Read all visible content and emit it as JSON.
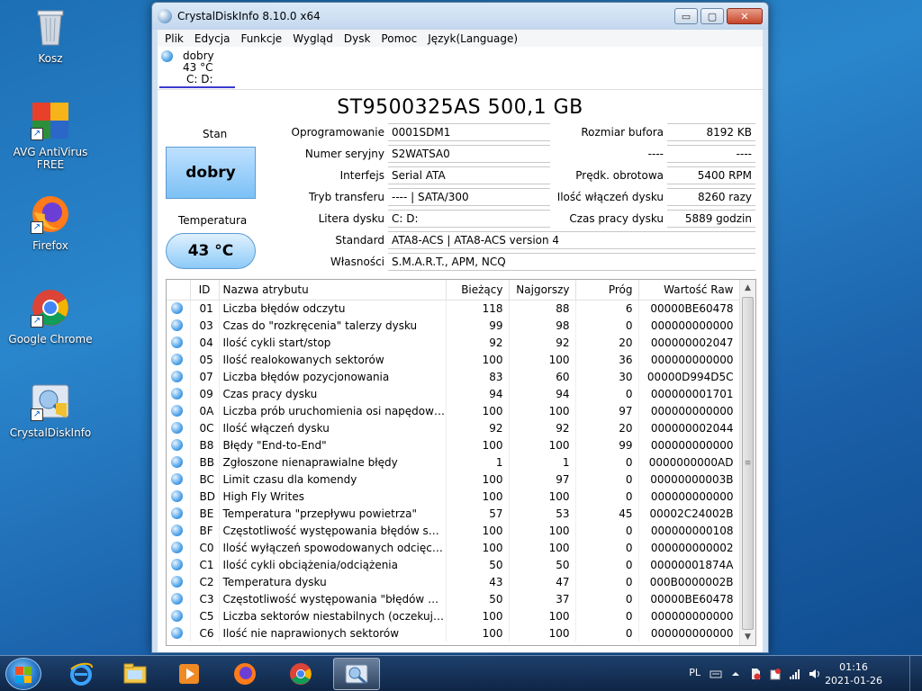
{
  "desktop": {
    "icons": [
      {
        "label": "Kosz"
      },
      {
        "label": "AVG AntiVirus FREE"
      },
      {
        "label": "Firefox"
      },
      {
        "label": "Google Chrome"
      },
      {
        "label": "CrystalDiskInfo"
      }
    ]
  },
  "window": {
    "title": "CrystalDiskInfo 8.10.0 x64",
    "minimize": "▭",
    "maximize": "▢",
    "close": "✕",
    "menu": [
      "Plik",
      "Edycja",
      "Funkcje",
      "Wygląd",
      "Dysk",
      "Pomoc",
      "Język(Language)"
    ]
  },
  "drive_tab": {
    "status": "dobry",
    "temp": "43 °C",
    "letters": "C: D:"
  },
  "disk": {
    "model": "ST9500325AS 500,1 GB",
    "stan_label": "Stan",
    "status": "dobry",
    "temp_label": "Temperatura",
    "temp": "43 °C",
    "left": [
      {
        "label": "Oprogramowanie",
        "value": "0001SDM1"
      },
      {
        "label": "Numer seryjny",
        "value": "S2WATSA0"
      },
      {
        "label": "Interfejs",
        "value": "Serial ATA"
      },
      {
        "label": "Tryb transferu",
        "value": "---- | SATA/300"
      },
      {
        "label": "Litera dysku",
        "value": "C: D:"
      }
    ],
    "right": [
      {
        "label": "Rozmiar bufora",
        "value": "8192 KB"
      },
      {
        "label": "----",
        "value": "----"
      },
      {
        "label": "Prędk. obrotowa",
        "value": "5400 RPM"
      },
      {
        "label": "Ilość włączeń dysku",
        "value": "8260 razy"
      },
      {
        "label": "Czas pracy dysku",
        "value": "5889 godzin"
      }
    ],
    "standard_label": "Standard",
    "standard": "ATA8-ACS | ATA8-ACS version 4",
    "features_label": "Własności",
    "features": "S.M.A.R.T., APM, NCQ"
  },
  "smart": {
    "headers": [
      "ID",
      "Nazwa atrybutu",
      "Bieżący",
      "Najgorszy",
      "Próg",
      "Wartość Raw"
    ],
    "rows": [
      [
        "01",
        "Liczba błędów odczytu",
        "118",
        "88",
        "6",
        "00000BE60478"
      ],
      [
        "03",
        "Czas do \"rozkręcenia\" talerzy dysku",
        "99",
        "98",
        "0",
        "000000000000"
      ],
      [
        "04",
        "Ilość cykli start/stop",
        "92",
        "92",
        "20",
        "000000002047"
      ],
      [
        "05",
        "Ilość realokowanych sektorów",
        "100",
        "100",
        "36",
        "000000000000"
      ],
      [
        "07",
        "Liczba błędów pozycjonowania",
        "83",
        "60",
        "30",
        "00000D994D5C"
      ],
      [
        "09",
        "Czas pracy dysku",
        "94",
        "94",
        "0",
        "000000001701"
      ],
      [
        "0A",
        "Liczba prób uruchomienia osi napędowej dy...",
        "100",
        "100",
        "97",
        "000000000000"
      ],
      [
        "0C",
        "Ilość włączeń dysku",
        "92",
        "92",
        "20",
        "000000002044"
      ],
      [
        "B8",
        "Błędy \"End-to-End\"",
        "100",
        "100",
        "99",
        "000000000000"
      ],
      [
        "BB",
        "Zgłoszone nienaprawialne błędy",
        "1",
        "1",
        "0",
        "0000000000AD"
      ],
      [
        "BC",
        "Limit czasu dla komendy",
        "100",
        "97",
        "0",
        "00000000003B"
      ],
      [
        "BD",
        "High Fly Writes",
        "100",
        "100",
        "0",
        "000000000000"
      ],
      [
        "BE",
        "Temperatura \"przepływu powietrza\"",
        "57",
        "53",
        "45",
        "00002C24002B"
      ],
      [
        "BF",
        "Częstotliwość występowania błędów spowo...",
        "100",
        "100",
        "0",
        "000000000108"
      ],
      [
        "C0",
        "Ilość wyłączeń spowodowanych odcięciem z...",
        "100",
        "100",
        "0",
        "000000000002"
      ],
      [
        "C1",
        "Ilość cykli obciążenia/odciążenia",
        "50",
        "50",
        "0",
        "00000001874A"
      ],
      [
        "C2",
        "Temperatura dysku",
        "43",
        "47",
        "0",
        "000B0000002B"
      ],
      [
        "C3",
        "Częstotliwość występowania \"błędów w locie\"",
        "50",
        "37",
        "0",
        "00000BE60478"
      ],
      [
        "C5",
        "Liczba sektorów niestabilnych (oczekującyc...",
        "100",
        "100",
        "0",
        "000000000000"
      ],
      [
        "C6",
        "Ilość nie naprawionych sektorów",
        "100",
        "100",
        "0",
        "000000000000"
      ]
    ]
  },
  "taskbar": {
    "lang": "PL",
    "time": "01:16",
    "date": "2021-01-26"
  },
  "colors": {
    "accent": "#4fa3e8",
    "status_bg": "#7cc1f5"
  }
}
